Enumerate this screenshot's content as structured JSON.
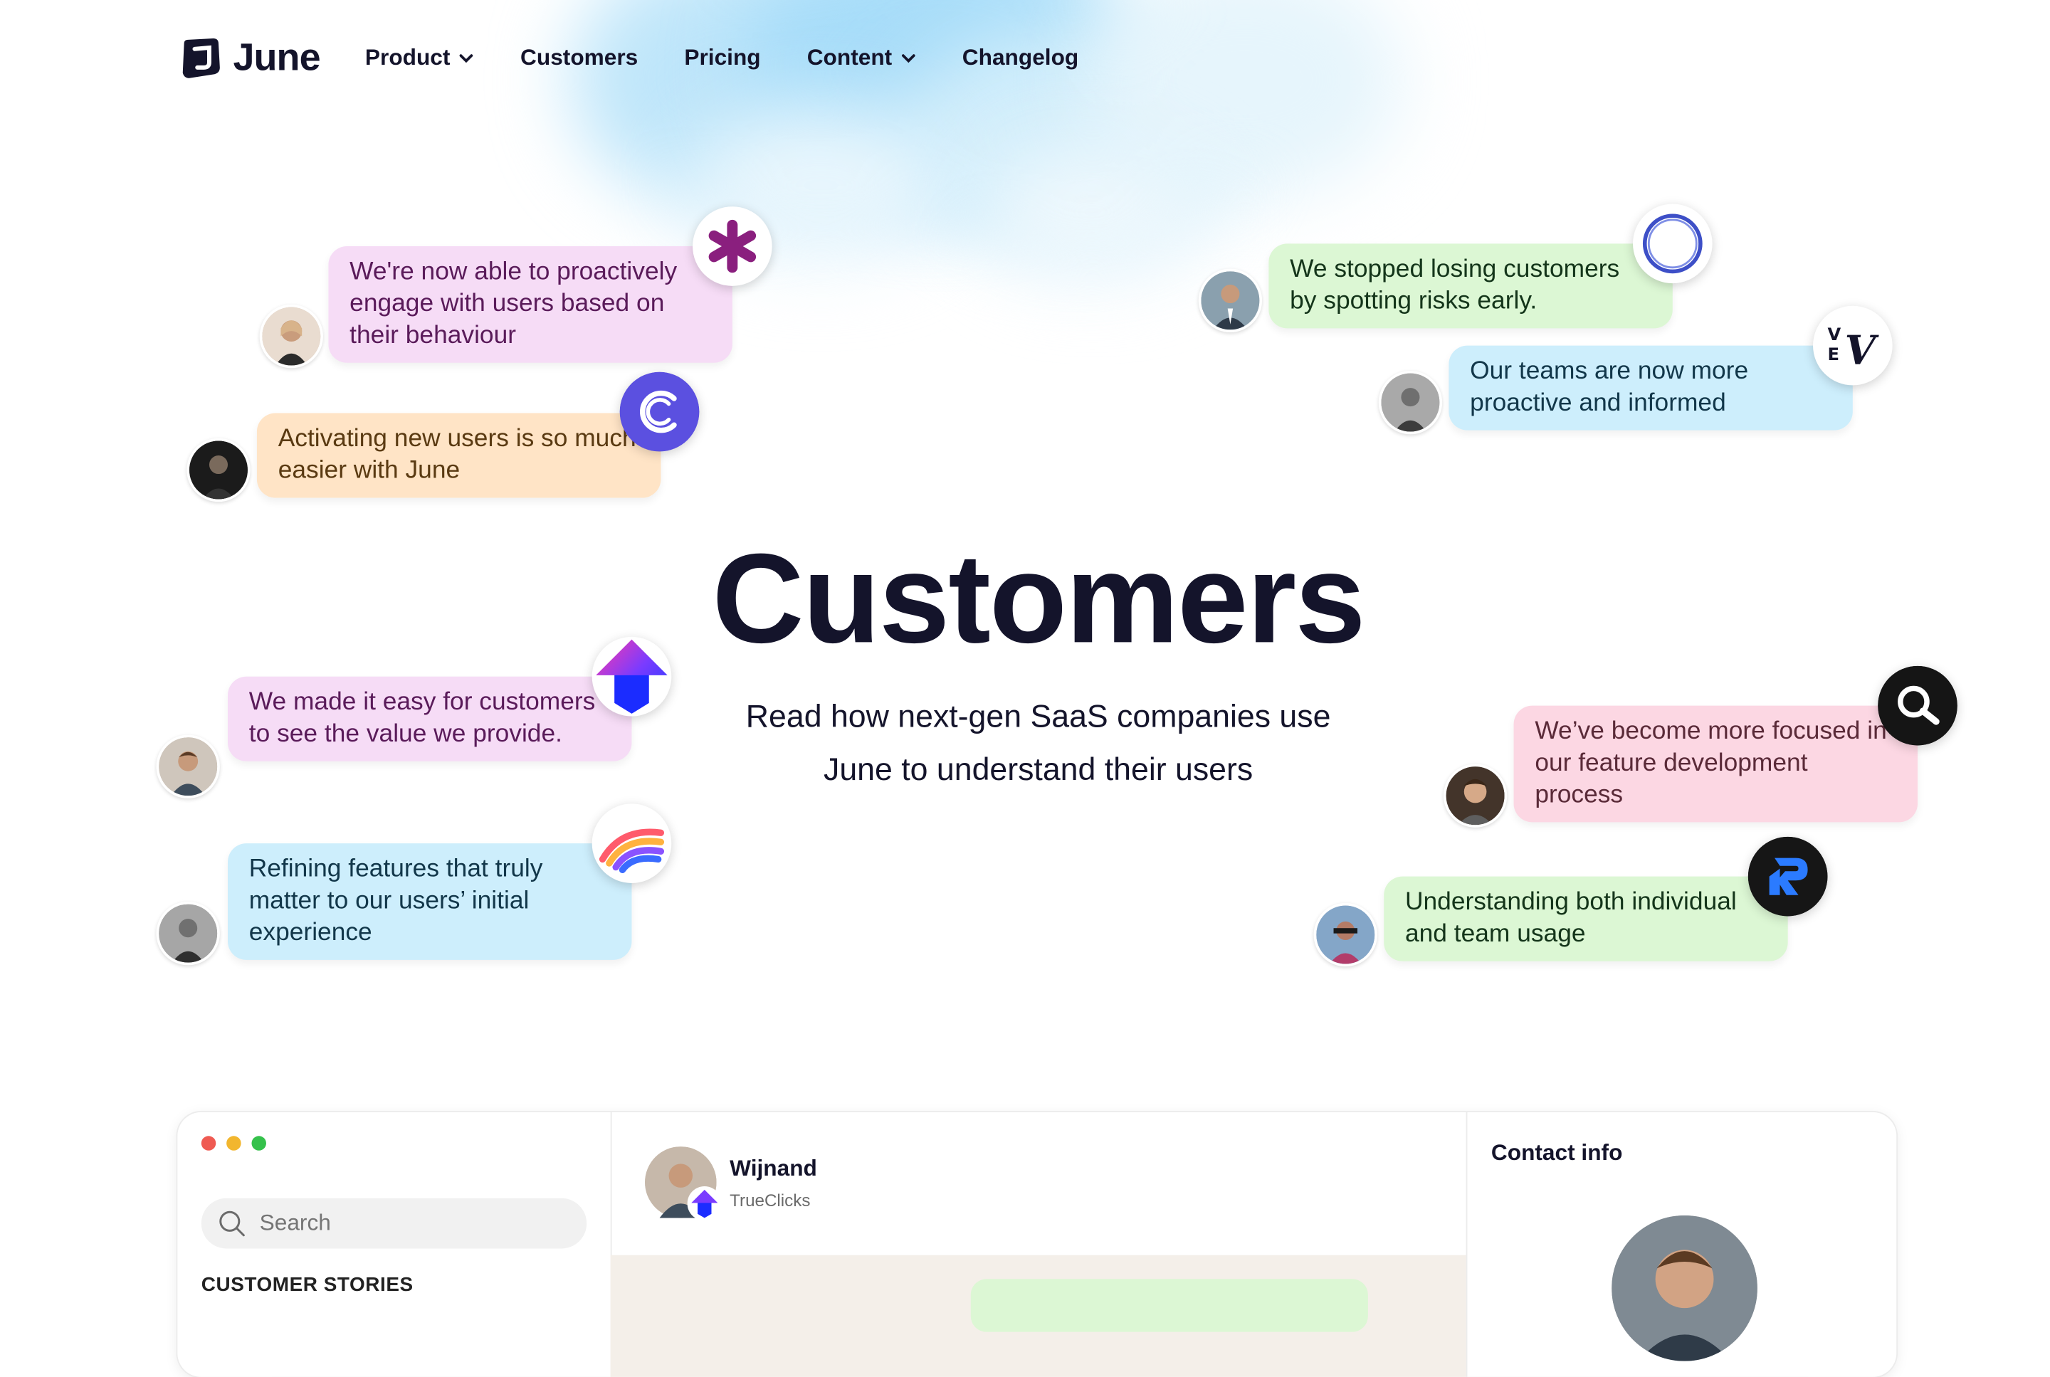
{
  "nav": {
    "brand": "June",
    "items": [
      {
        "label": "Product",
        "has_dropdown": true
      },
      {
        "label": "Customers",
        "has_dropdown": false
      },
      {
        "label": "Pricing",
        "has_dropdown": false
      },
      {
        "label": "Content",
        "has_dropdown": true
      },
      {
        "label": "Changelog",
        "has_dropdown": false
      }
    ]
  },
  "hero": {
    "title": "Customers",
    "subtitle": "Read how next-gen SaaS companies use June to understand their users"
  },
  "testimonials": [
    {
      "text": "We're now able to proactively engage with users based on their behaviour",
      "color": "#f6dcf6",
      "logo": "asterisk-logo-icon"
    },
    {
      "text": "Activating new users is so much easier with June",
      "color": "#ffe4c6",
      "logo": "c-logo-icon"
    },
    {
      "text": "We stopped losing customers by spotting risks early.",
      "color": "#dcf7d4",
      "logo": "ring-logo-icon"
    },
    {
      "text": "Our teams are now more proactive and informed",
      "color": "#cdeefc",
      "logo": "vev-logo-icon"
    },
    {
      "text": "We made it easy for customers to see the value we provide.",
      "color": "#f6dcf6",
      "logo": "arrow-logo-icon"
    },
    {
      "text": "Refining features that truly matter to our users’ initial experience",
      "color": "#cdeefc",
      "logo": "rainbow-logo-icon"
    },
    {
      "text": "We’ve become more focused in our feature development process",
      "color": "#fcd7e3",
      "logo": "magnifier-logo-icon"
    },
    {
      "text": "Understanding both individual and team usage",
      "color": "#dcf7d4",
      "logo": "r-logo-icon"
    }
  ],
  "app": {
    "search_placeholder": "Search",
    "section_heading": "CUSTOMER STORIES",
    "chat": {
      "name": "Wijnand",
      "company": "TrueClicks"
    },
    "contact_title": "Contact info"
  }
}
